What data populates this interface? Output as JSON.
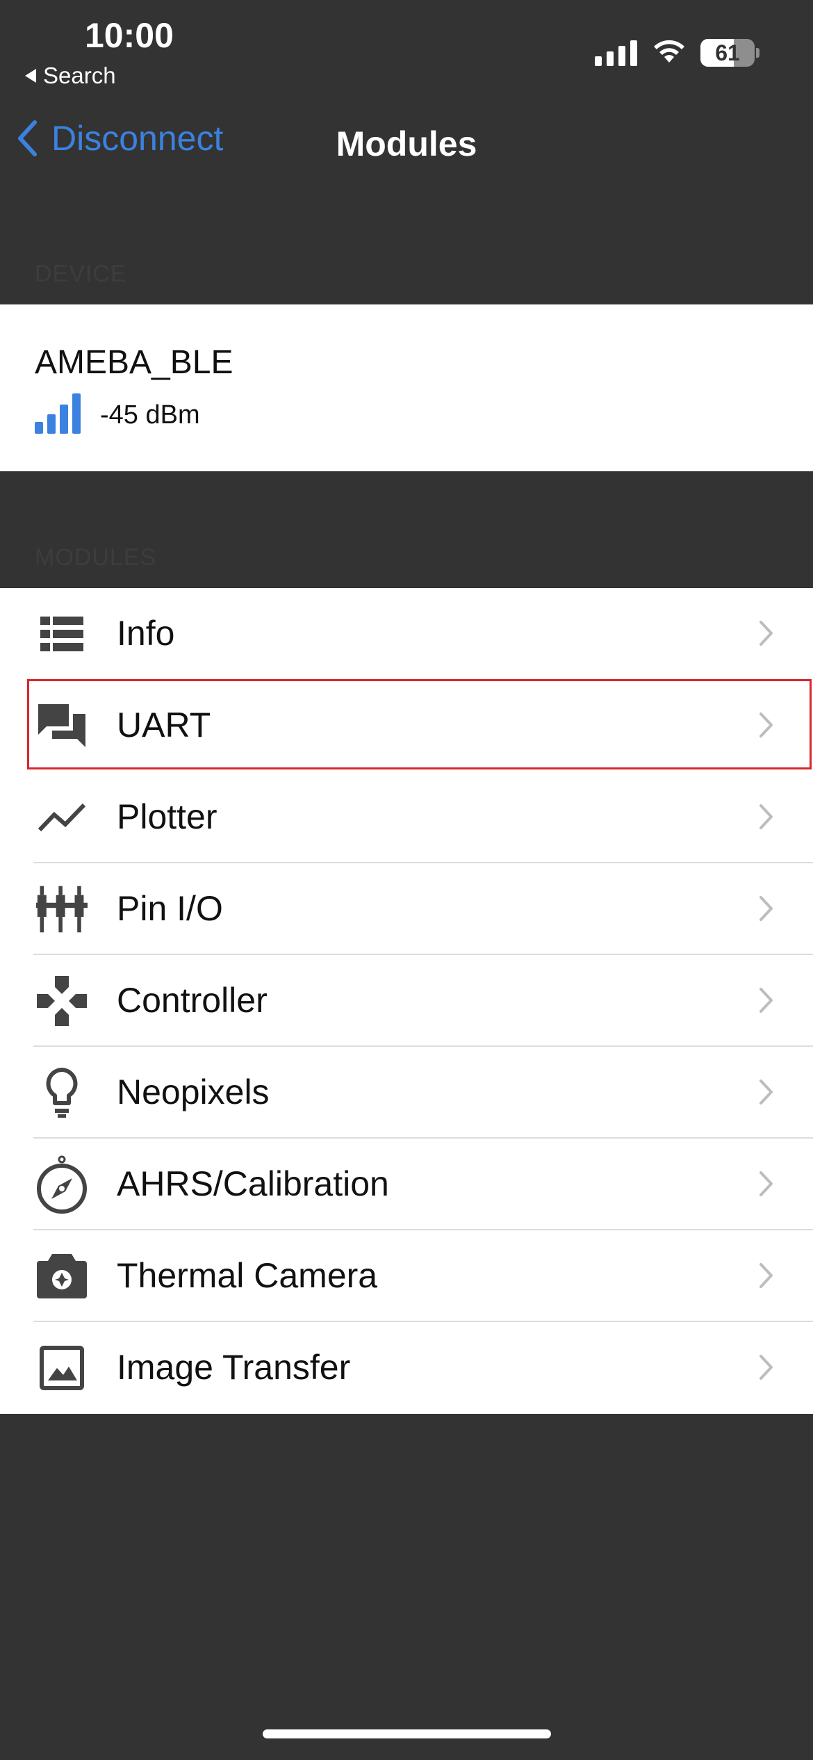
{
  "status_bar": {
    "time": "10:00",
    "back_app": "Search",
    "battery": "61"
  },
  "nav": {
    "back_label": "Disconnect",
    "title": "Modules"
  },
  "device_section": {
    "header": "DEVICE",
    "name": "AMEBA_BLE",
    "rssi": "-45 dBm"
  },
  "modules_section": {
    "header": "MODULES",
    "items": [
      {
        "label": "Info",
        "icon": "list-icon"
      },
      {
        "label": "UART",
        "icon": "chat-icon"
      },
      {
        "label": "Plotter",
        "icon": "chart-line-icon"
      },
      {
        "label": "Pin I/O",
        "icon": "pins-icon"
      },
      {
        "label": "Controller",
        "icon": "gamepad-icon"
      },
      {
        "label": "Neopixels",
        "icon": "lightbulb-icon"
      },
      {
        "label": "AHRS/Calibration",
        "icon": "compass-icon"
      },
      {
        "label": "Thermal Camera",
        "icon": "camera-icon"
      },
      {
        "label": "Image Transfer",
        "icon": "image-icon"
      }
    ]
  },
  "colors": {
    "accent": "#3b82e0",
    "background": "#333333",
    "highlight": "#d9252b"
  }
}
